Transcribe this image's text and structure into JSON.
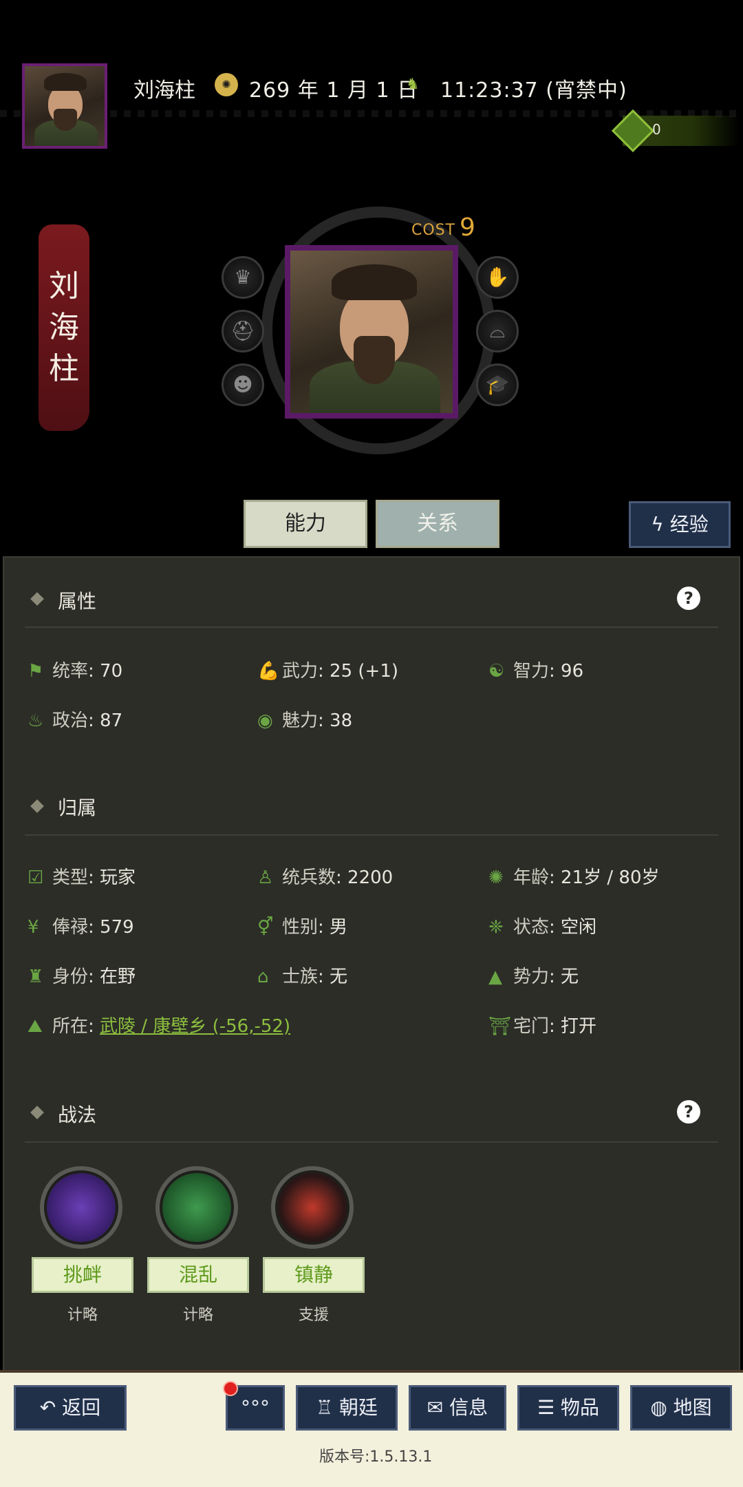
{
  "header": {
    "name": "刘海柱",
    "date": "269 年 1 月 1 日",
    "time": "11:23:37 (宵禁中)",
    "money": "0"
  },
  "general": {
    "banner_chars": [
      "刘",
      "海",
      "柱"
    ],
    "cost_label": "COST",
    "cost_value": "9"
  },
  "tabs": {
    "ability": "能力",
    "relation": "关系",
    "experience": "经验"
  },
  "attributes": {
    "title": "属性",
    "items": [
      {
        "label": "统率",
        "value": "70"
      },
      {
        "label": "武力",
        "value": "25 (+1)"
      },
      {
        "label": "智力",
        "value": "96"
      },
      {
        "label": "政治",
        "value": "87"
      },
      {
        "label": "魅力",
        "value": "38"
      }
    ]
  },
  "affiliation": {
    "title": "归属",
    "items": [
      {
        "label": "类型",
        "value": "玩家"
      },
      {
        "label": "统兵数",
        "value": "2200"
      },
      {
        "label": "年龄",
        "value": "21岁 / 80岁"
      },
      {
        "label": "俸禄",
        "value": "579"
      },
      {
        "label": "性别",
        "value": "男"
      },
      {
        "label": "状态",
        "value": "空闲"
      },
      {
        "label": "身份",
        "value": "在野"
      },
      {
        "label": "士族",
        "value": "无"
      },
      {
        "label": "势力",
        "value": "无"
      },
      {
        "label": "所在",
        "value": "武陵 / 康壁乡 (-56,-52)"
      },
      {
        "label": "宅门",
        "value": "打开"
      }
    ]
  },
  "tactics": {
    "title": "战法",
    "skills": [
      {
        "name": "挑衅",
        "type": "计略"
      },
      {
        "name": "混乱",
        "type": "计略"
      },
      {
        "name": "镇静",
        "type": "支援"
      }
    ]
  },
  "bottom_nav": {
    "back": "返回",
    "more": "°°°",
    "court": "朝廷",
    "info": "信息",
    "items": "物品",
    "map": "地图"
  },
  "version": "版本号:1.5.13.1",
  "colors": {
    "accent_green": "#6aa644",
    "link_green": "#8cbf3e",
    "frame_purple": "#5b1a66",
    "button_navy": "#213049",
    "banner_red": "#7a1a1f"
  }
}
